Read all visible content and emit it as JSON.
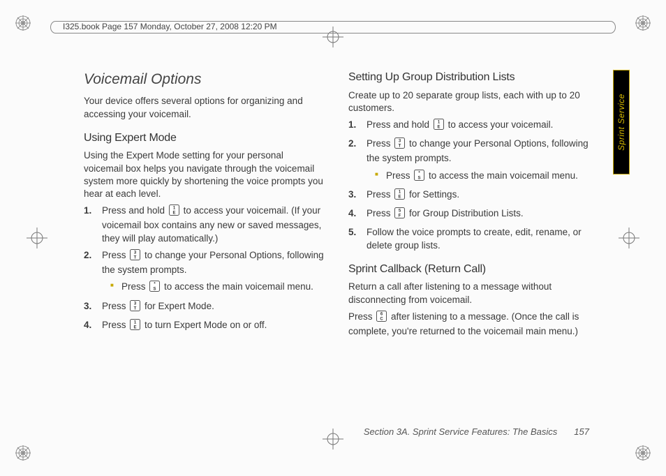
{
  "header_text": "I325.book  Page 157  Monday, October 27, 2008  12:20 PM",
  "side_tab": "Sprint Service",
  "footer": {
    "section": "Section 3A. Sprint Service Features: The Basics",
    "page": "157"
  },
  "left": {
    "title": "Voicemail Options",
    "intro": "Your device offers several options for organizing and accessing your voicemail.",
    "h_expert": "Using Expert Mode",
    "expert_intro": "Using the Expert Mode setting for your personal voicemail box helps you navigate through the voicemail system more quickly by shortening the voice prompts you hear at each level.",
    "s1a": "Press and hold ",
    "s1b": " to access your voicemail. (If your voicemail box contains any new or saved messages, they will play automatically.)",
    "s2a": "Press ",
    "s2b": " to change your Personal Options, following the system prompts.",
    "s2n_a": "Press ",
    "s2n_b": " to access the main voicemail menu.",
    "s3a": "Press ",
    "s3b": " for Expert Mode.",
    "s4a": "Press ",
    "s4b": " to turn Expert Mode on or off."
  },
  "right": {
    "h_group": "Setting Up Group Distribution Lists",
    "group_intro": "Create up to 20 separate group lists, each with up to 20 customers.",
    "g1a": "Press and hold ",
    "g1b": " to access your voicemail.",
    "g2a": "Press ",
    "g2b": " to change your Personal Options, following the system prompts.",
    "g2n_a": "Press ",
    "g2n_b": " to access the main voicemail menu.",
    "g3a": "Press ",
    "g3b": " for Settings.",
    "g4a": "Press ",
    "g4b": " for Group Distribution Lists.",
    "g5": "Follow the voice prompts to create, edit, rename, or delete group lists.",
    "h_callback": "Sprint Callback (Return Call)",
    "callback_intro": "Return a call after listening to a message without disconnecting from voicemail.",
    "cb_a": "Press ",
    "cb_b": " after listening to a message. (Once the call is complete, you're returned to the voicemail main menu.)"
  },
  "keys": {
    "k1": {
      "top": "1",
      "bot": "E"
    },
    "k3": {
      "top": "3",
      "bot": "T"
    },
    "k5": {
      "top": "5",
      "bot": "F"
    },
    "k6": {
      "top": "6",
      "bot": "C"
    },
    "kstar": {
      "top": "*",
      "bot": "S"
    }
  }
}
